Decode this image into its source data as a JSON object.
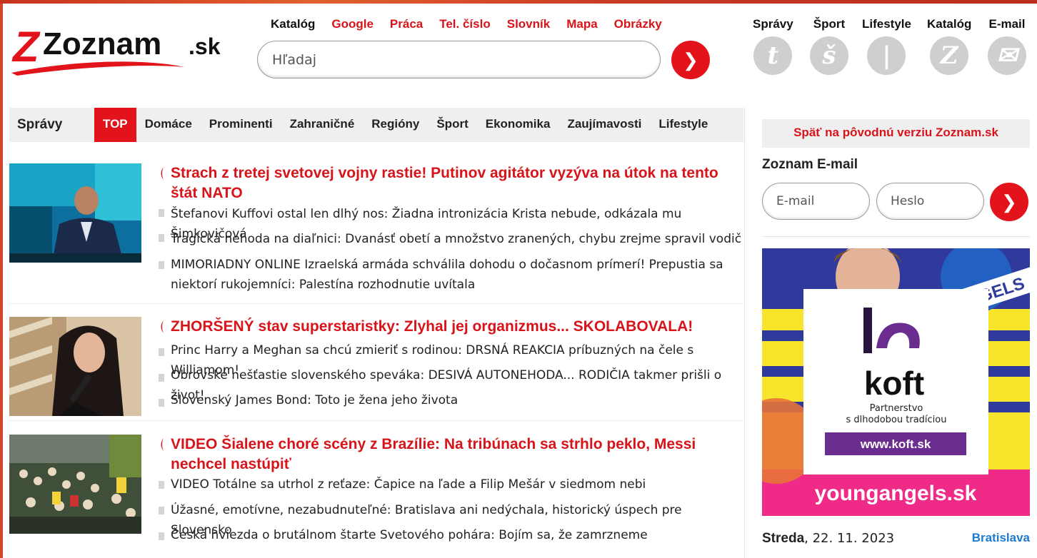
{
  "logo": {
    "main": "Zoznam",
    "suffix": ".sk"
  },
  "top_links": [
    {
      "label": "Katalóg",
      "style": "dark"
    },
    {
      "label": "Google",
      "style": "red"
    },
    {
      "label": "Práca",
      "style": "red"
    },
    {
      "label": "Tel. číslo",
      "style": "red"
    },
    {
      "label": "Slovník",
      "style": "red"
    },
    {
      "label": "Mapa",
      "style": "red"
    },
    {
      "label": "Obrázky",
      "style": "red"
    }
  ],
  "search": {
    "placeholder": "Hľadaj",
    "button_icon": "chevron-right-icon",
    "button_glyph": "❯"
  },
  "services": [
    {
      "label": "Správy",
      "glyph": "t",
      "icon": "spravy-icon"
    },
    {
      "label": "Šport",
      "glyph": "š",
      "icon": "sport-icon"
    },
    {
      "label": "Lifestyle",
      "glyph": "|",
      "icon": "lifestyle-icon"
    },
    {
      "label": "Katalóg",
      "glyph": "Z",
      "icon": "katalog-icon"
    },
    {
      "label": "E-mail",
      "glyph": "✉",
      "icon": "mail-icon"
    }
  ],
  "category_nav": {
    "lead": "Správy",
    "items": [
      "TOP",
      "Domáce",
      "Prominenti",
      "Zahraničné",
      "Regióny",
      "Šport",
      "Ekonomika",
      "Zaujímavosti",
      "Lifestyle"
    ],
    "active": "TOP"
  },
  "stories": [
    {
      "headline": "Strach z tretej svetovej vojny rastie! Putinov agitátor vyzýva na útok na tento štát NATO",
      "subs": [
        "Štefanovi Kuffovi ostal len dlhý nos: Žiadna intronizácia Krista nebude, odkázala mu Šimkovičová",
        "Tragická nehoda na diaľnici: Dvanásť obetí a množstvo zranených, chybu zrejme spravil vodič",
        "MIMORIADNY ONLINE Izraelská armáda schválila dohodu o dočasnom prímerí! Prepustia sa niektorí rukojemníci: Palestína rozhodnutie uvítala"
      ]
    },
    {
      "headline": "ZHORŠENÝ stav superstaristky: Zlyhal jej organizmus... SKOLABOVALA!",
      "subs": [
        "Princ Harry a Meghan sa chcú zmieriť s rodinou: DRSNÁ REAKCIA príbuzných na čele s Williamom!",
        "Obrovské nešťastie slovenského speváka: DESIVÁ AUTONEHODA... RODIČIA takmer prišli o život!",
        "Slovenský James Bond: Toto je žena jeho života"
      ]
    },
    {
      "headline": "VIDEO Šialene choré scény z Brazílie: Na tribúnach sa strhlo peklo, Messi nechcel nastúpiť",
      "subs": [
        "VIDEO Totálne sa utrhol z reťaze: Čapice na ľade a Filip Mešár v siedmom nebi",
        "Úžasné, emotívne, nezabudnuteľné: Bratislava ani nedýchala, historický úspech pre Slovensko",
        "Česká hviezda o brutálnom štarte Svetového pohára: Bojím sa, že zamrzneme"
      ]
    }
  ],
  "sidebar": {
    "back_link": "Späť na pôvodnú verziu Zoznam.sk",
    "mail_title": "Zoznam E-mail",
    "email_placeholder": "E-mail",
    "password_placeholder": "Heslo",
    "login_glyph": "❯"
  },
  "ad": {
    "badge_text": "ANGELS",
    "brand": "koft",
    "tagline_1": "Partnerstvo",
    "tagline_2": "s dlhodobou tradíciou",
    "url": "www.koft.sk",
    "footer": "youngangels.sk",
    "colors": {
      "blue": "#2f3a9c",
      "yellow": "#f6e52b",
      "pink": "#ef2a87",
      "purple": "#6b2c8f"
    }
  },
  "date": {
    "day": "Streda",
    "date": "22. 11. 2023",
    "city": "Bratislava"
  },
  "colors": {
    "accent": "#e3131b",
    "link_red": "#d7141a",
    "city_blue": "#1b7bd1"
  }
}
